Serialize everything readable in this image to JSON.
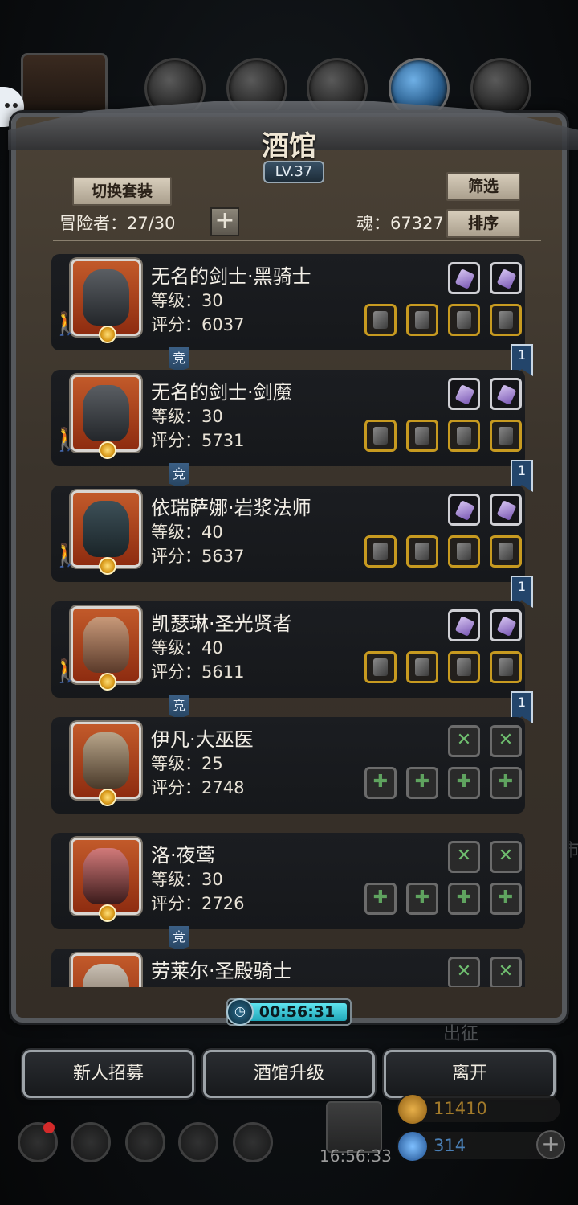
{
  "window": {
    "title": "酒馆",
    "level": "LV.37"
  },
  "toolbar": {
    "switch_outfit": "切换套装",
    "filter": "筛选",
    "sort": "排序",
    "adventurers_label": "冒险者：27/30",
    "soul_label": "魂：67327",
    "add": "+"
  },
  "heroes": [
    {
      "name": "无名的剑士·黑骑士",
      "level": "等级：30",
      "score": "评分：6037",
      "jing": "竞",
      "rank": "1"
    },
    {
      "name": "无名的剑士·剑魔",
      "level": "等级：30",
      "score": "评分：5731",
      "jing": "竞",
      "rank": "1"
    },
    {
      "name": "依瑞萨娜·岩浆法师",
      "level": "等级：40",
      "score": "评分：5637",
      "rank": "1"
    },
    {
      "name": "凯瑟琳·圣光贤者",
      "level": "等级：40",
      "score": "评分：5611",
      "jing": "竞",
      "rank": "1"
    },
    {
      "name": "伊凡·大巫医",
      "level": "等级：25",
      "score": "评分：2748"
    },
    {
      "name": "洛·夜莺",
      "level": "等级：30",
      "score": "评分：2726",
      "jing": "竞"
    },
    {
      "name": "劳莱尔·圣殿骑士"
    }
  ],
  "timer": {
    "value": "00:56:31"
  },
  "background": {
    "sortie": "出征",
    "side": "市"
  },
  "actions": {
    "recruit": "新人招募",
    "upgrade": "酒馆升级",
    "leave": "离开"
  },
  "hud": {
    "clock": "16:56:33",
    "gold": "11410",
    "gems": "314",
    "plus": "+"
  },
  "colors": {
    "gold_border": "#c79a20",
    "accent_cyan": "#5fe4ef",
    "panel_bg": "#3a332b"
  }
}
